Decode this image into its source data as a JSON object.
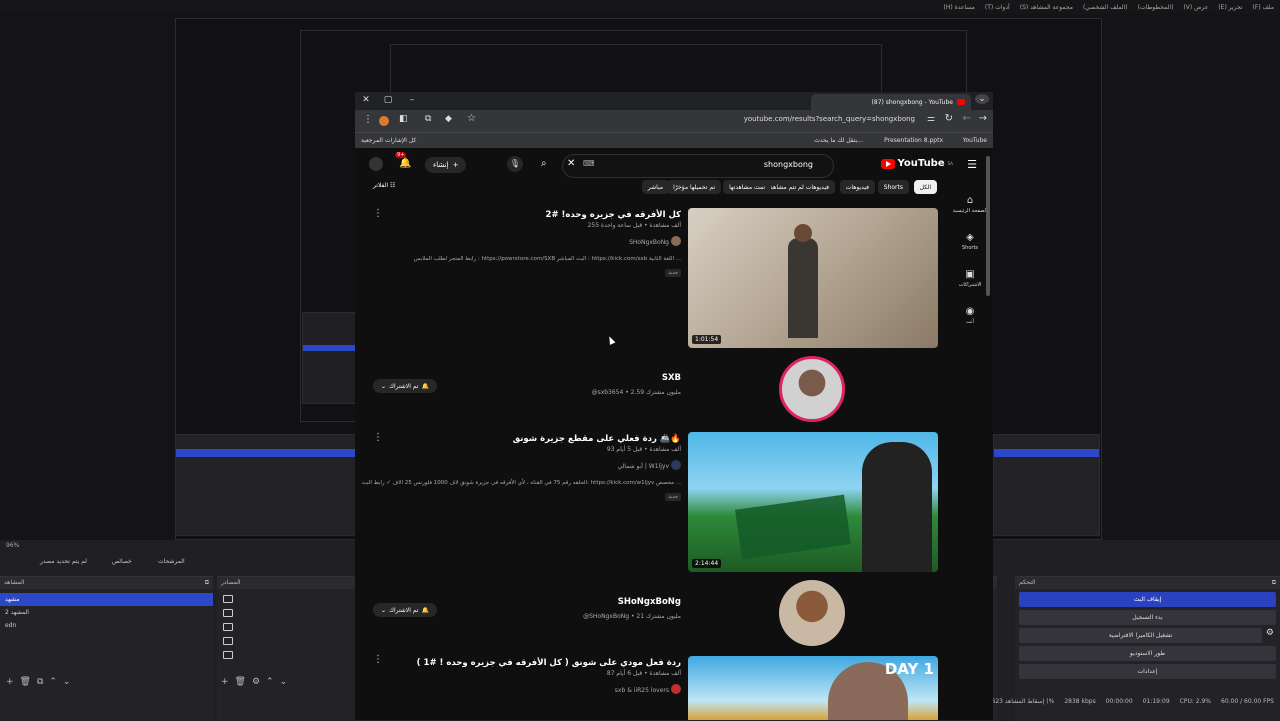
{
  "obs": {
    "menu": [
      "ملف (F)",
      "تحرير (E)",
      "عرض (V)",
      "(المخطوطات)",
      "(الملف الشخصي)",
      "مجموعة المشاهد (S)",
      "أدوات (T)",
      "مساعدة (H)"
    ],
    "zoom": "96%",
    "display_tabs": [
      "لم يتم تحديد مصدر",
      "خصائص",
      "المرشحات"
    ],
    "scenes_title": "المشاهد",
    "scenes": [
      "مشهد",
      "المشهد 2",
      "edn"
    ],
    "sources_title": "المصادر",
    "controls_title": "التحكم",
    "controls": [
      "إيقاف البث",
      "بدء التسجيل",
      "تشغيل الكاميرا الافتراضية",
      "طور الاستوديو",
      "إعدادات"
    ],
    "status": {
      "dropped": "إسقاط المشاهد 623 (%",
      "bitrate": "2838 kbps",
      "rec_time": "00:00:00",
      "live_time": "01:19:09",
      "cpu": "CPU: 2.9%",
      "fps": "60.00 / 60.00 FPS"
    }
  },
  "browser": {
    "tab_title": "(87) shongxbong - YouTube",
    "url": "youtube.com/results?search_query=shongxbong",
    "bookmarks": [
      "YouTube",
      "Presentation 8.pptx",
      "يتقل لك ما يحدث...",
      "كل الإشارات المرجعية"
    ]
  },
  "youtube": {
    "logo": "YouTube",
    "country": "SA",
    "search_value": "shongxbong",
    "create_label": "إنشاء",
    "notif_count": "9+",
    "chips": [
      "الكل",
      "Shorts",
      "فيديوهات",
      "فيديوهات لم تتم مشاهدتها",
      "تمت مشاهدتها",
      "تم تحميلها مؤخرًا",
      "مباشر"
    ],
    "filter_label": "الفلاتر",
    "sidebar": [
      "الصفحة الرئيسية",
      "Shorts",
      "الاشتراكات",
      "أنت"
    ],
    "videos": [
      {
        "title": "كل الأفرقه في جزيره وحده! #2",
        "views": "255 ألف مشاهدة • قبل ساعة واحدة",
        "channel": "SHoNgxBoNg",
        "desc": "رابط المتجر لطلب الملابس : https://powrstore.com/SXB البث المباشر : https://kick.com/sxb اللغة الثانية ...",
        "badge": "جديد",
        "duration": "1:01:54"
      },
      {
        "title": "ردة فعلي على مقطع جزيرة شونق 🚢🔥",
        "views": "93 ألف مشاهدة • قبل 5 أيام",
        "channel": "أبو شمالي | W1ljyv",
        "desc": "الحلقه رقم 75 في القناه ، لأي الأفرقه في جزيرة شونق لاف 1000 فلورنس 25 الاف ✓ رابط البث: https://kick.com/w1ljyv مخصص ...",
        "badge": "جديد",
        "duration": "2:14:44"
      },
      {
        "title": "ردة فعل مودي على شونق ( كل الأفرقه في جزيره وحده ! #1 )",
        "views": "87 ألف مشاهدة • قبل 6 أيام",
        "channel": "sxb & iiR25 lovers",
        "duration": "DAY 1"
      }
    ],
    "channels": [
      {
        "name": "SXB",
        "meta": "@sxb3654 • 2.59 مليون مشترك",
        "sub": "تم الاشتراك"
      },
      {
        "name": "SHoNgxBoNg",
        "meta": "@SHoNgxBoNg • 21 مليون مشترك",
        "sub": "تم الاشتراك"
      }
    ]
  },
  "colors": {
    "obs_blue": "#2b48c9",
    "yt_red": "#ff0000"
  }
}
